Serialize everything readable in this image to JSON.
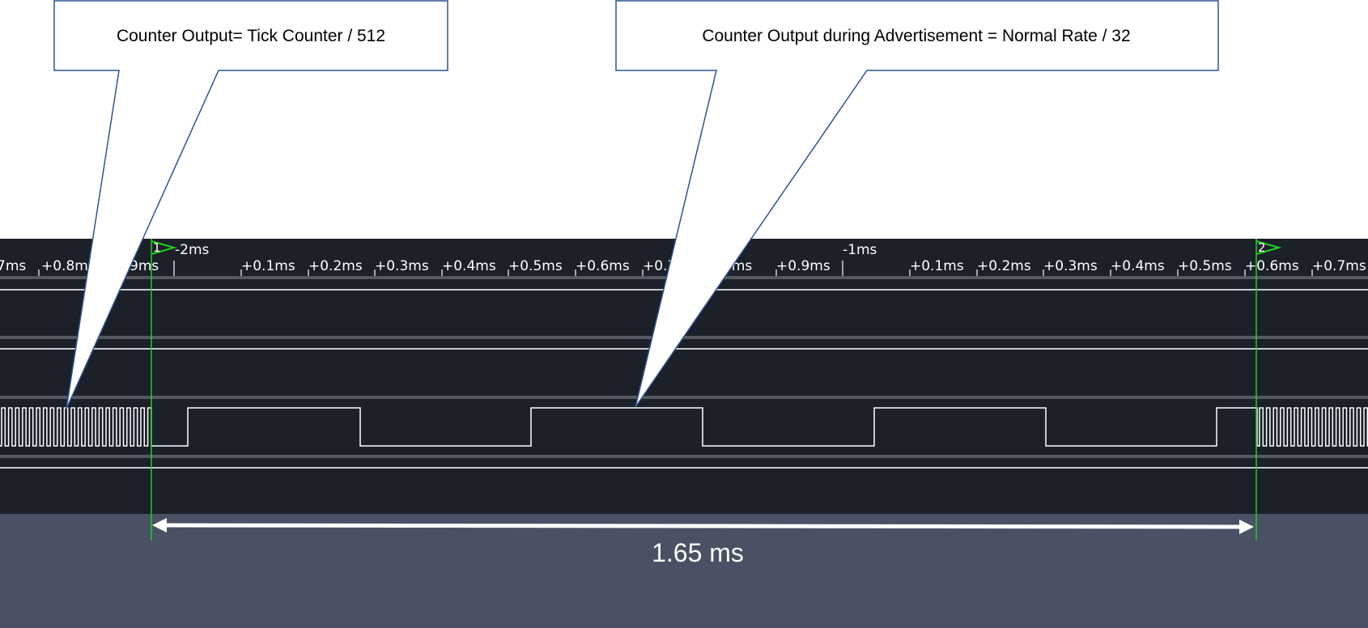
{
  "callouts": [
    {
      "id": "tick-counter",
      "text": "Counter Output= Tick Counter / 512"
    },
    {
      "id": "advertisement",
      "text": "Counter Output during Advertisement = Normal Rate / 32"
    }
  ],
  "timeline": {
    "major_labels": [
      "-2ms",
      "-1ms"
    ],
    "minor_labels": [
      "7ms",
      "+0.8ms",
      "9ms",
      "+0.1ms",
      "+0.2ms",
      "+0.3ms",
      "+0.4ms",
      "+0.5ms",
      "+0.6ms",
      "+0.7",
      "8ms",
      "+0.9ms",
      "+0.1ms",
      "+0.2ms",
      "+0.3ms",
      "+0.4ms",
      "+0.5ms",
      "+0.6ms",
      "+0.7ms"
    ]
  },
  "markers": [
    {
      "label": "1"
    },
    {
      "label": "2"
    }
  ],
  "measurement": {
    "label": "1.65 ms"
  },
  "colors": {
    "plot_background": "#1b2029",
    "lower_panel": "#4a5164",
    "channel_separator": "#555a61",
    "signal": "#ffffff",
    "marker": "#1ed11e",
    "callout_border": "#2f5496"
  }
}
